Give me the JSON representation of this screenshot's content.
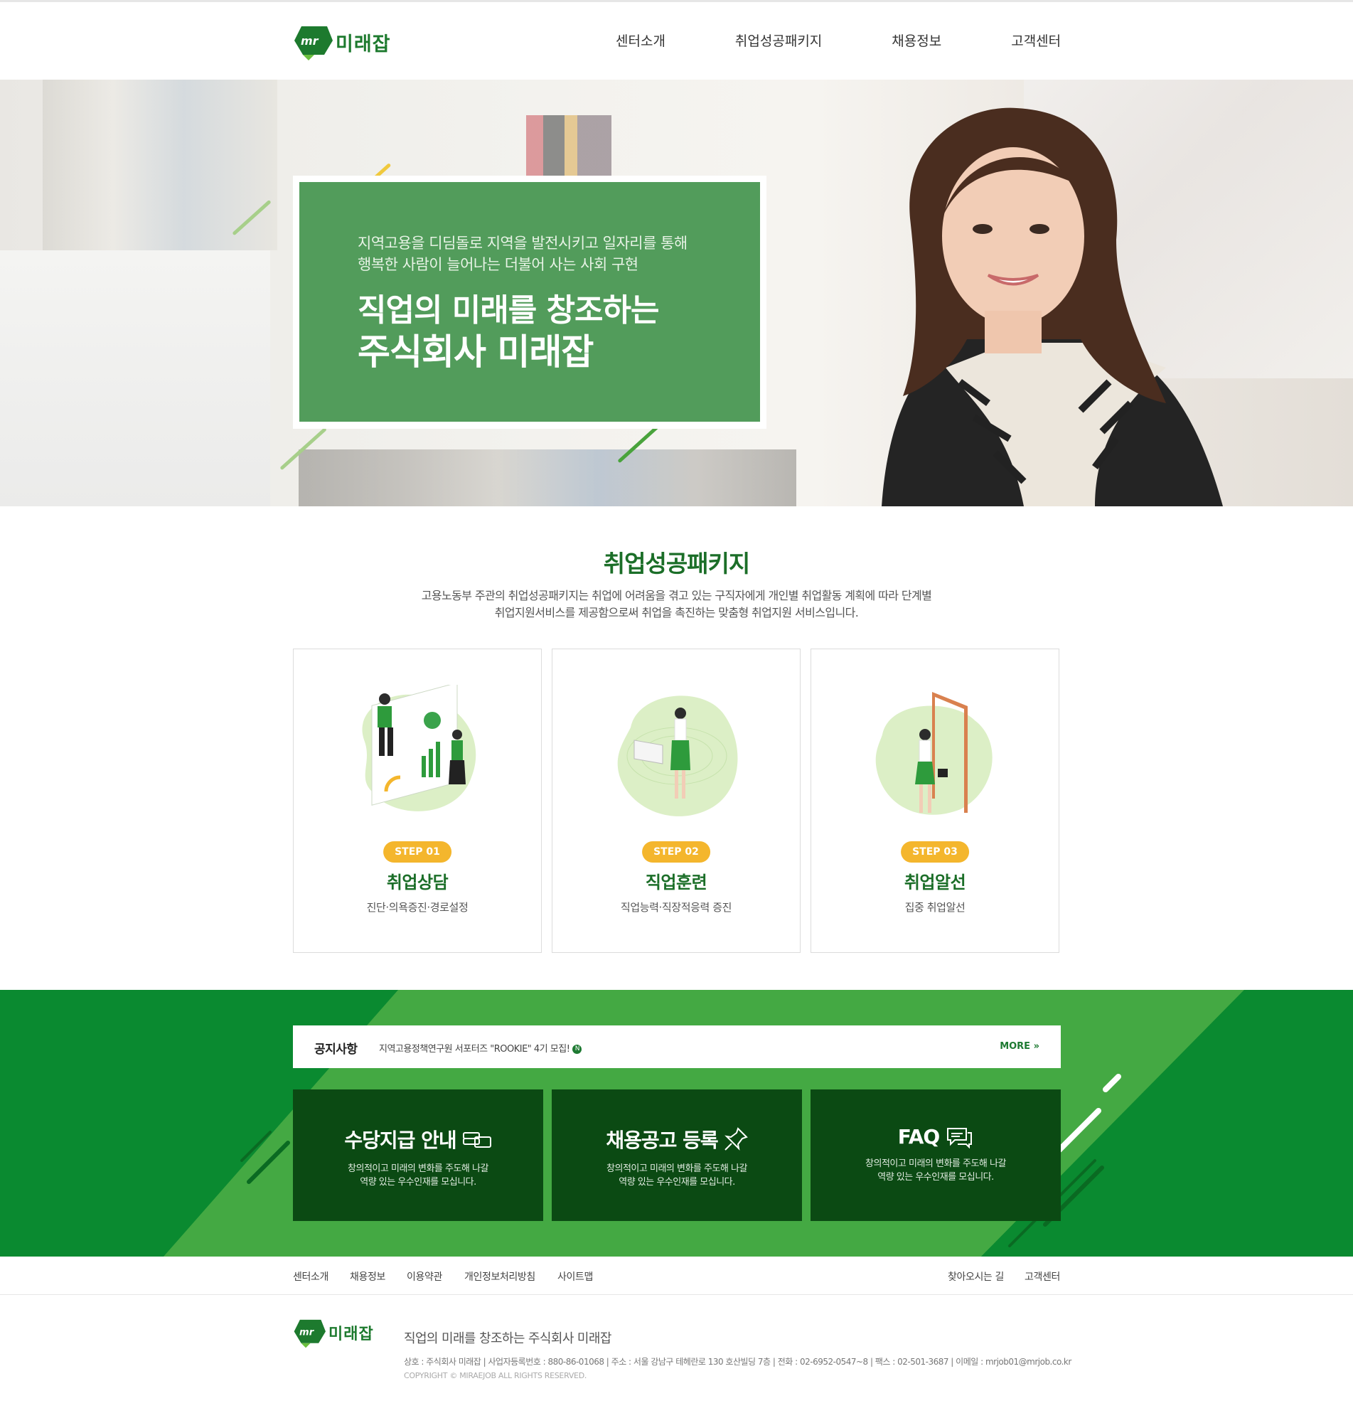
{
  "header": {
    "logo_text": "미래잡",
    "nav": [
      "센터소개",
      "취업성공패키지",
      "채용정보",
      "고객센터"
    ]
  },
  "hero": {
    "subtitle_line1": "지역고용을 디딤돌로 지역을 발전시키고 일자리를 통해",
    "subtitle_line2": "행복한 사람이 늘어나는 더불어 사는 사회 구현",
    "title_line1": "직업의 미래를 창조하는",
    "title_line2": "주식회사 미래잡"
  },
  "package": {
    "title": "취업성공패키지",
    "desc_line1": "고용노동부 주관의 취업성공패키지는 취업에 어려움을 겪고 있는 구직자에게 개인별 취업활동 계획에 따라 단계별",
    "desc_line2": "취업지원서비스를 제공함으로써 취업을 촉진하는 맞춤형 취업지원 서비스입니다.",
    "cards": [
      {
        "step": "STEP 01",
        "title": "취업상담",
        "desc": "진단·의욕증진·경로설정"
      },
      {
        "step": "STEP 02",
        "title": "직업훈련",
        "desc": "직업능력·직장적응력 증진"
      },
      {
        "step": "STEP 03",
        "title": "취업알선",
        "desc": "집중 취업알선"
      }
    ]
  },
  "notice": {
    "label": "공지사항",
    "text": "지역고용정책연구원 서포터즈 \"ROOKIE\" 4기 모집!",
    "new_badge": "N",
    "more": "MORE »"
  },
  "quick_boxes": [
    {
      "title": "수당지급 안내",
      "icon": "money-icon",
      "desc_line1": "창의적이고 미래의 변화를 주도해 나갈",
      "desc_line2": "역량 있는 우수인재를 모십니다."
    },
    {
      "title": "채용공고 등록",
      "icon": "pin-icon",
      "desc_line1": "창의적이고 미래의 변화를 주도해 나갈",
      "desc_line2": "역량 있는 우수인재를 모십니다."
    },
    {
      "title": "FAQ",
      "icon": "chat-icon",
      "desc_line1": "창의적이고 미래의 변화를 주도해 나갈",
      "desc_line2": "역량 있는 우수인재를 모십니다."
    }
  ],
  "footer": {
    "links_left": [
      "센터소개",
      "채용정보",
      "이용약관",
      "개인정보처리방침",
      "사이트맵"
    ],
    "links_right": [
      "찾아오시는 길",
      "고객센터"
    ],
    "logo_text": "미래잡",
    "slogan": "직업의 미래를 창조하는 주식회사 미래잡",
    "info": "상호 : 주식회사 미래잡 | 사업자등록번호 : 880-86-01068 | 주소 : 서울 강남구 테헤란로 130 호산빌딩 7층 | 전화 : 02-6952-0547~8 | 팩스 : 02-501-3687 | 이메일 : mrjob01@mrjob.co.kr",
    "copyright": "COPYRIGHT © MIRAEJOB ALL RIGHTS RESERVED."
  },
  "colors": {
    "brand_green": "#1b6e28",
    "band_green": "#0a8a30",
    "box_dark_green": "#0b4a13",
    "step_yellow": "#f4b62d"
  }
}
